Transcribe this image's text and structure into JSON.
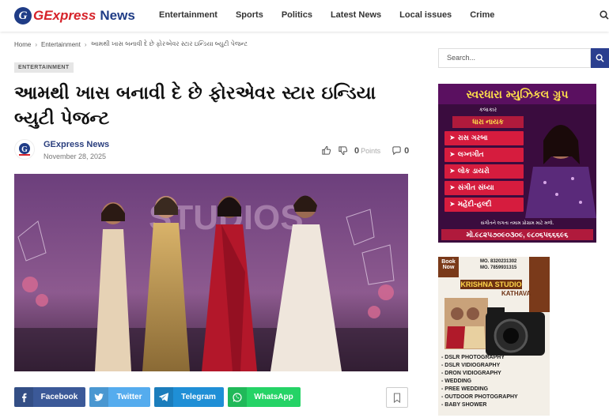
{
  "site": {
    "logo_mark": "G",
    "logo_text1": "GExpress",
    "logo_text2": "News"
  },
  "nav": {
    "items": [
      "Entertainment",
      "Sports",
      "Politics",
      "Latest News",
      "Local issues",
      "Crime"
    ]
  },
  "breadcrumb": {
    "home": "Home",
    "category": "Entertainment",
    "current": "આમથી ખાસ બનાવી દે છે ફોરએવર સ્ટાર ઇન્ડિયા બ્યુટી પેજન્ટ"
  },
  "article": {
    "category_badge": "ENTERTAINMENT",
    "title": "આમથી ખાસ બનાવી દે છે ફોરએવર સ્ટાર ઇન્ડિયા બ્યુટી પેજન્ટ",
    "author": "GExpress News",
    "date": "November 28, 2025",
    "points_value": "0",
    "points_label": "Points",
    "comments": "0",
    "hero_studio_text": "STUDIOS"
  },
  "share": {
    "facebook": "Facebook",
    "twitter": "Twitter",
    "telegram": "Telegram",
    "whatsapp": "WhatsApp"
  },
  "sidebar": {
    "search_placeholder": "Search...",
    "ad1": {
      "title": "સ્વરધારા મ્યુઝિકલ ગ્રુપ",
      "artist_label": "કલાકાર",
      "artist_name": "ધારા નાયક",
      "items": [
        "રાસ ગરબા",
        "લગ્નગીત",
        "લોક ડાયરો",
        "સંગીત સંધ્યા",
        "મહેંદી-હલ્દી",
        "ઓરકેસ્ટ્રા"
      ],
      "footer": "સંગીતને લગતા તમામ પ્રોગ્રામ માટે મળો.",
      "phone": "મો.૯૮૨૫૭૦૯૦૩૦૯, ૯૮૦૬૫૬૬૬૯૬"
    },
    "ad2": {
      "badge": "Book Now",
      "phone1": "MO. 8320231302",
      "phone2": "MO. 7859931315",
      "studio": "KRISHNA STUDIO",
      "place": "KATHAVA",
      "services": [
        "- DSLR PHOTOGRAPHY",
        "- DSLR VIDIOGRAPHY",
        "- DRON VIDIOGRAPHY",
        "- WEDDING",
        "- PREE WEDDING",
        "- OUTDOOR PHOTOGRAPHY",
        "- BABY SHOWER"
      ]
    }
  },
  "colors": {
    "brand_red": "#d6232a",
    "brand_blue": "#1f3c86",
    "facebook": "#3b5998",
    "twitter": "#55acee",
    "telegram": "#1f8fd6",
    "whatsapp": "#25d366"
  }
}
